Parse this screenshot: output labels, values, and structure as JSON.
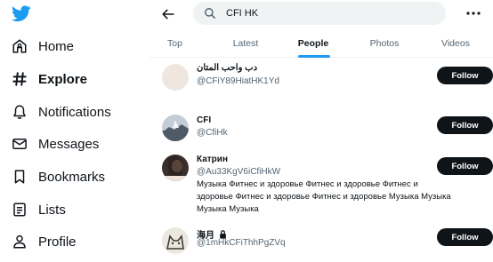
{
  "sidebar": {
    "logo": "twitter-bird-icon",
    "items": [
      {
        "label": "Home",
        "icon": "home-icon"
      },
      {
        "label": "Explore",
        "icon": "hashtag-icon",
        "active": true
      },
      {
        "label": "Notifications",
        "icon": "bell-icon"
      },
      {
        "label": "Messages",
        "icon": "envelope-icon"
      },
      {
        "label": "Bookmarks",
        "icon": "bookmark-icon"
      },
      {
        "label": "Lists",
        "icon": "list-icon"
      },
      {
        "label": "Profile",
        "icon": "person-icon"
      }
    ]
  },
  "header": {
    "search_value": "CFI HK"
  },
  "tabs": [
    {
      "label": "Top"
    },
    {
      "label": "Latest"
    },
    {
      "label": "People",
      "active": true
    },
    {
      "label": "Photos"
    },
    {
      "label": "Videos"
    }
  ],
  "results": [
    {
      "name": "دب واحب المتان",
      "handle": "@CFiY89HiatHK1Yd",
      "bio": "",
      "follow_label": "Follow"
    },
    {
      "name": "CFI",
      "handle": "@CfiHk",
      "bio": "",
      "follow_label": "Follow"
    },
    {
      "name": "Катрин",
      "handle": "@Au33KgV6iCfiHkW",
      "bio": "Музыка Фитнес и здоровье Фитнес и здоровье Фитнес и здоровье Фитнес и здоровье Фитнес и здоровье Музыка Музыка Музыка Музыка",
      "follow_label": "Follow"
    },
    {
      "name": "海月",
      "handle": "@1mHkCFiThhPgZVq",
      "bio": "",
      "follow_label": "Follow",
      "protected": true
    }
  ],
  "colors": {
    "accent": "#1d9bf0",
    "text": "#0f1419",
    "muted": "#536471"
  }
}
